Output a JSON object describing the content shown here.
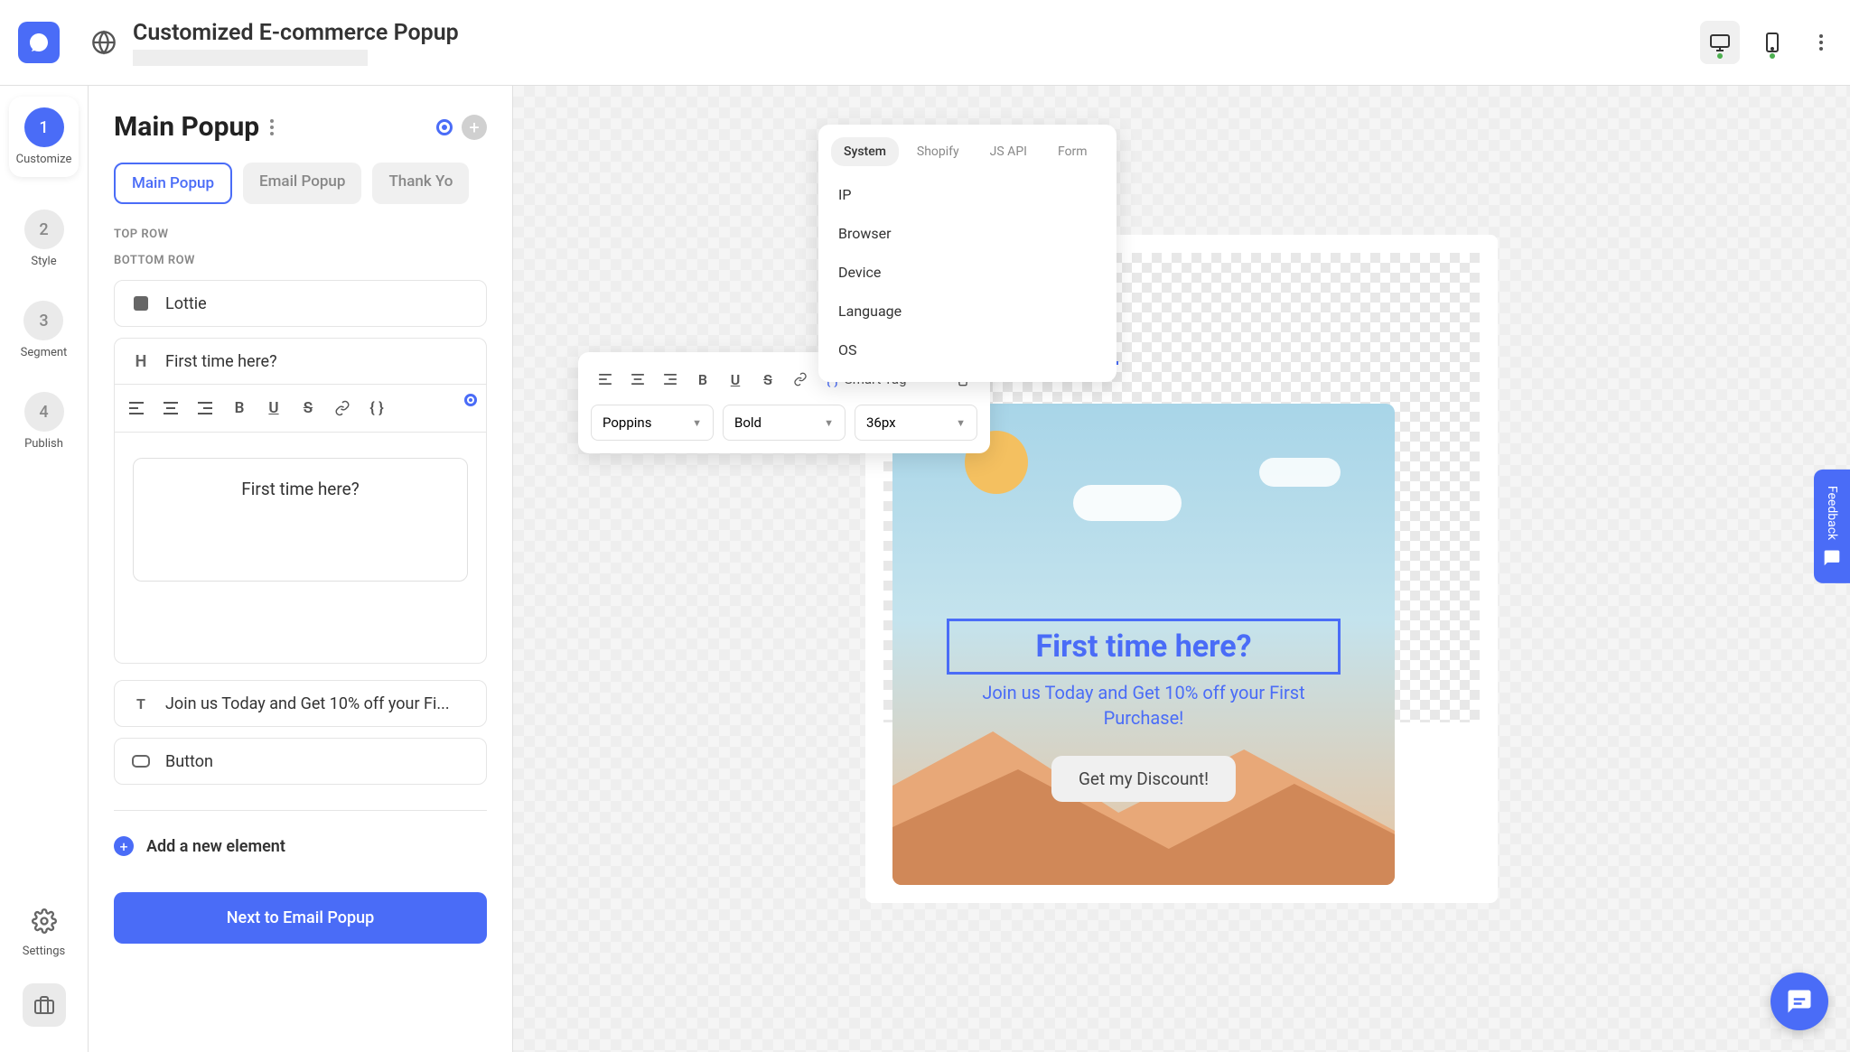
{
  "header": {
    "title": "Customized E-commerce Popup"
  },
  "rail": {
    "steps": [
      {
        "num": "1",
        "label": "Customize"
      },
      {
        "num": "2",
        "label": "Style"
      },
      {
        "num": "3",
        "label": "Segment"
      },
      {
        "num": "4",
        "label": "Publish"
      }
    ],
    "settings_label": "Settings"
  },
  "panel": {
    "title": "Main Popup",
    "tabs": [
      {
        "label": "Main Popup",
        "active": true
      },
      {
        "label": "Email Popup",
        "active": false
      },
      {
        "label": "Thank Yo",
        "active": false
      }
    ],
    "top_row_label": "TOP ROW",
    "bottom_row_label": "BOTTOM ROW",
    "elements": {
      "lottie": "Lottie",
      "heading": "First time here?",
      "preview_text": "First time here?",
      "body_text": "Join us Today and Get 10% off your Fi...",
      "button": "Button"
    },
    "add_element": "Add a new element",
    "next_button": "Next to Email Popup"
  },
  "floating_toolbar": {
    "smart_tag_label": "Smart Tag",
    "font_family": "Poppins",
    "font_weight": "Bold",
    "font_size": "36px"
  },
  "smart_dropdown": {
    "tabs": [
      "System",
      "Shopify",
      "JS API",
      "Form"
    ],
    "items": [
      "IP",
      "Browser",
      "Device",
      "Language",
      "OS"
    ]
  },
  "popup_preview": {
    "heading": "First time here?",
    "subtext": "Join us Today and Get 10% off your First Purchase!",
    "cta": "Get my Discount!"
  },
  "feedback": {
    "label": "Feedback"
  }
}
